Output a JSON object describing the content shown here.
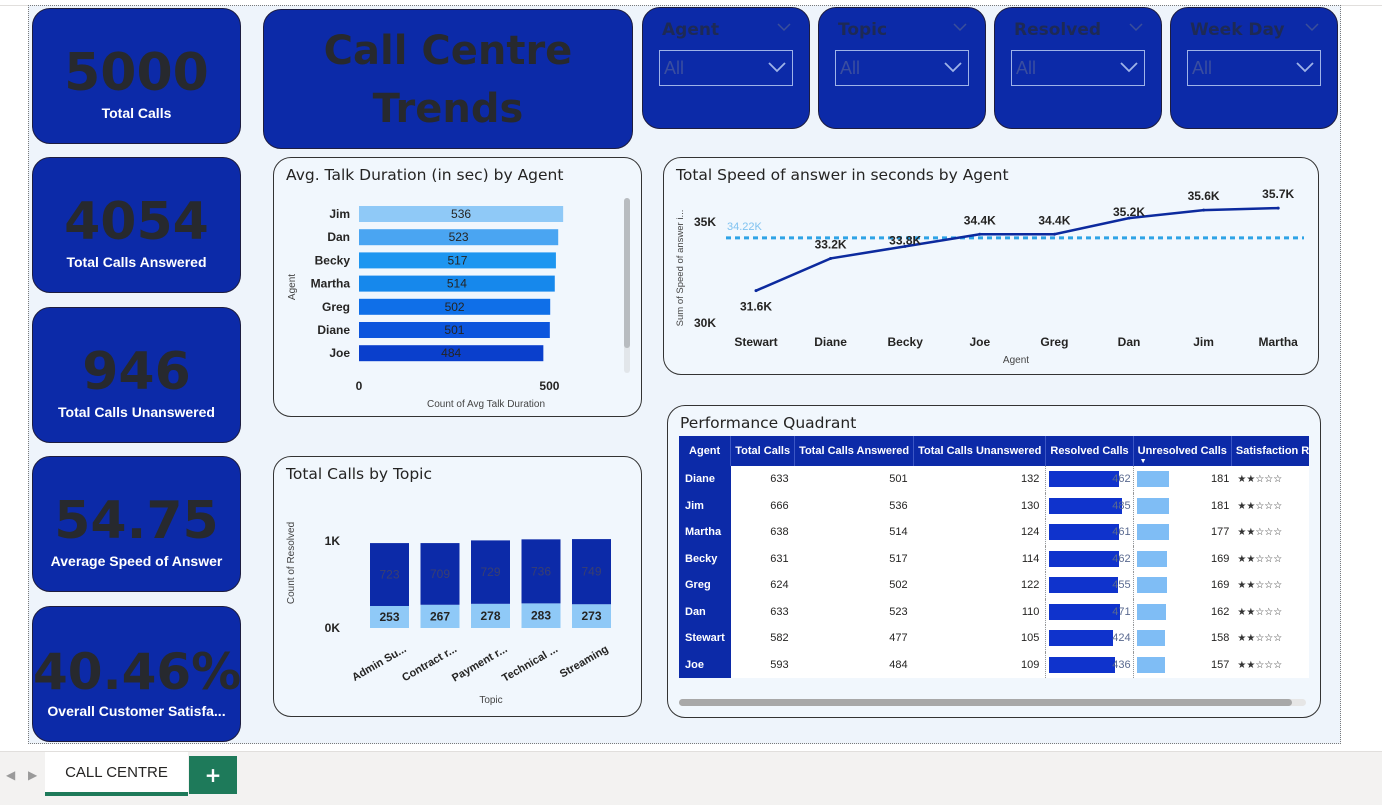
{
  "kpis": [
    {
      "value": "5000",
      "label": "Total Calls"
    },
    {
      "value": "4054",
      "label": "Total Calls Answered"
    },
    {
      "value": "946",
      "label": "Total Calls Unanswered"
    },
    {
      "value": "54.75",
      "label": "Average Speed of Answer"
    },
    {
      "value": "40.46%",
      "label": "Overall Customer Satisfa..."
    }
  ],
  "title": {
    "line1": "Call Centre",
    "line2": "Trends"
  },
  "slicers": [
    {
      "title": "Agent",
      "value": "All"
    },
    {
      "title": "Topic",
      "value": "All"
    },
    {
      "title": "Resolved",
      "value": "All"
    },
    {
      "title": "Week Day",
      "value": "All"
    }
  ],
  "talk_chart": {
    "title": "Avg. Talk Duration (in sec) by Agent",
    "xlabel": "Count of Avg Talk Duration",
    "ylabel": "Agent",
    "ticks": [
      "0",
      "500"
    ],
    "xlim": [
      0,
      560
    ],
    "categories": [
      "Jim",
      "Dan",
      "Becky",
      "Martha",
      "Greg",
      "Diane",
      "Joe"
    ],
    "values": [
      536,
      523,
      517,
      514,
      502,
      501,
      484
    ],
    "colors": [
      "#8fc9f7",
      "#4aa5f2",
      "#1e96f0",
      "#1688ec",
      "#0f6fe8",
      "#0c55dd",
      "#0a3fcc"
    ]
  },
  "topic_chart": {
    "title": "Total Calls by Topic",
    "ylabel": "Count of Resolved",
    "xlabel": "Topic",
    "yticks": [
      "1K",
      "0K"
    ],
    "ylim": [
      0,
      1100
    ],
    "categories": [
      "Admin Su...",
      "Contract r...",
      "Payment r...",
      "Technical ...",
      "Streaming"
    ],
    "series": [
      {
        "values": [
          253,
          267,
          278,
          283,
          273
        ],
        "color": "#8fc9f7"
      },
      {
        "values": [
          723,
          709,
          729,
          736,
          749
        ],
        "color": "#0c2aa8"
      }
    ]
  },
  "speed_chart": {
    "title": "Total Speed of answer in seconds by Agent",
    "ylabel": "Sum of Speed of answer i...",
    "xlabel": "Agent",
    "yticks": [
      "35K",
      "30K"
    ],
    "ylim": [
      29500,
      36200
    ],
    "avg_label": "34.22K",
    "avg_value": 34220,
    "categories": [
      "Stewart",
      "Diane",
      "Becky",
      "Joe",
      "Greg",
      "Dan",
      "Jim",
      "Martha"
    ],
    "values": [
      31600,
      33200,
      33800,
      34400,
      34400,
      35200,
      35600,
      35700
    ],
    "labels": [
      "31.6K",
      "33.2K",
      "33.8K",
      "34.4K",
      "34.4K",
      "35.2K",
      "35.6K",
      "35.7K"
    ],
    "line_color": "#0c2a9e",
    "avg_color": "#2ea3e6"
  },
  "quadrant": {
    "title": "Performance Quadrant",
    "columns": [
      "Agent",
      "Total Calls",
      "Total Calls Answered",
      "Total Calls Unanswered",
      "Resolved Calls",
      "Unresolved Calls",
      "Satisfaction Rat"
    ],
    "rows": [
      {
        "agent": "Diane",
        "total": "633",
        "answered": "501",
        "unanswered": "132",
        "resolved": "462",
        "unresolved": "181",
        "stars": "★★☆☆☆"
      },
      {
        "agent": "Jim",
        "total": "666",
        "answered": "536",
        "unanswered": "130",
        "resolved": "485",
        "unresolved": "181",
        "stars": "★★☆☆☆"
      },
      {
        "agent": "Martha",
        "total": "638",
        "answered": "514",
        "unanswered": "124",
        "resolved": "461",
        "unresolved": "177",
        "stars": "★★☆☆☆"
      },
      {
        "agent": "Becky",
        "total": "631",
        "answered": "517",
        "unanswered": "114",
        "resolved": "462",
        "unresolved": "169",
        "stars": "★★☆☆☆"
      },
      {
        "agent": "Greg",
        "total": "624",
        "answered": "502",
        "unanswered": "122",
        "resolved": "455",
        "unresolved": "169",
        "stars": "★★☆☆☆"
      },
      {
        "agent": "Dan",
        "total": "633",
        "answered": "523",
        "unanswered": "110",
        "resolved": "471",
        "unresolved": "162",
        "stars": "★★☆☆☆"
      },
      {
        "agent": "Stewart",
        "total": "582",
        "answered": "477",
        "unanswered": "105",
        "resolved": "424",
        "unresolved": "158",
        "stars": "★★☆☆☆"
      },
      {
        "agent": "Joe",
        "total": "593",
        "answered": "484",
        "unanswered": "109",
        "resolved": "436",
        "unresolved": "157",
        "stars": "★★☆☆☆"
      }
    ]
  },
  "sheet_tab": {
    "label": "CALL CENTRE",
    "add": "+"
  },
  "colors": {
    "accent": "#0c2aa8",
    "canvas": "#eef4fb",
    "sheet_green": "#1e7a5a"
  }
}
